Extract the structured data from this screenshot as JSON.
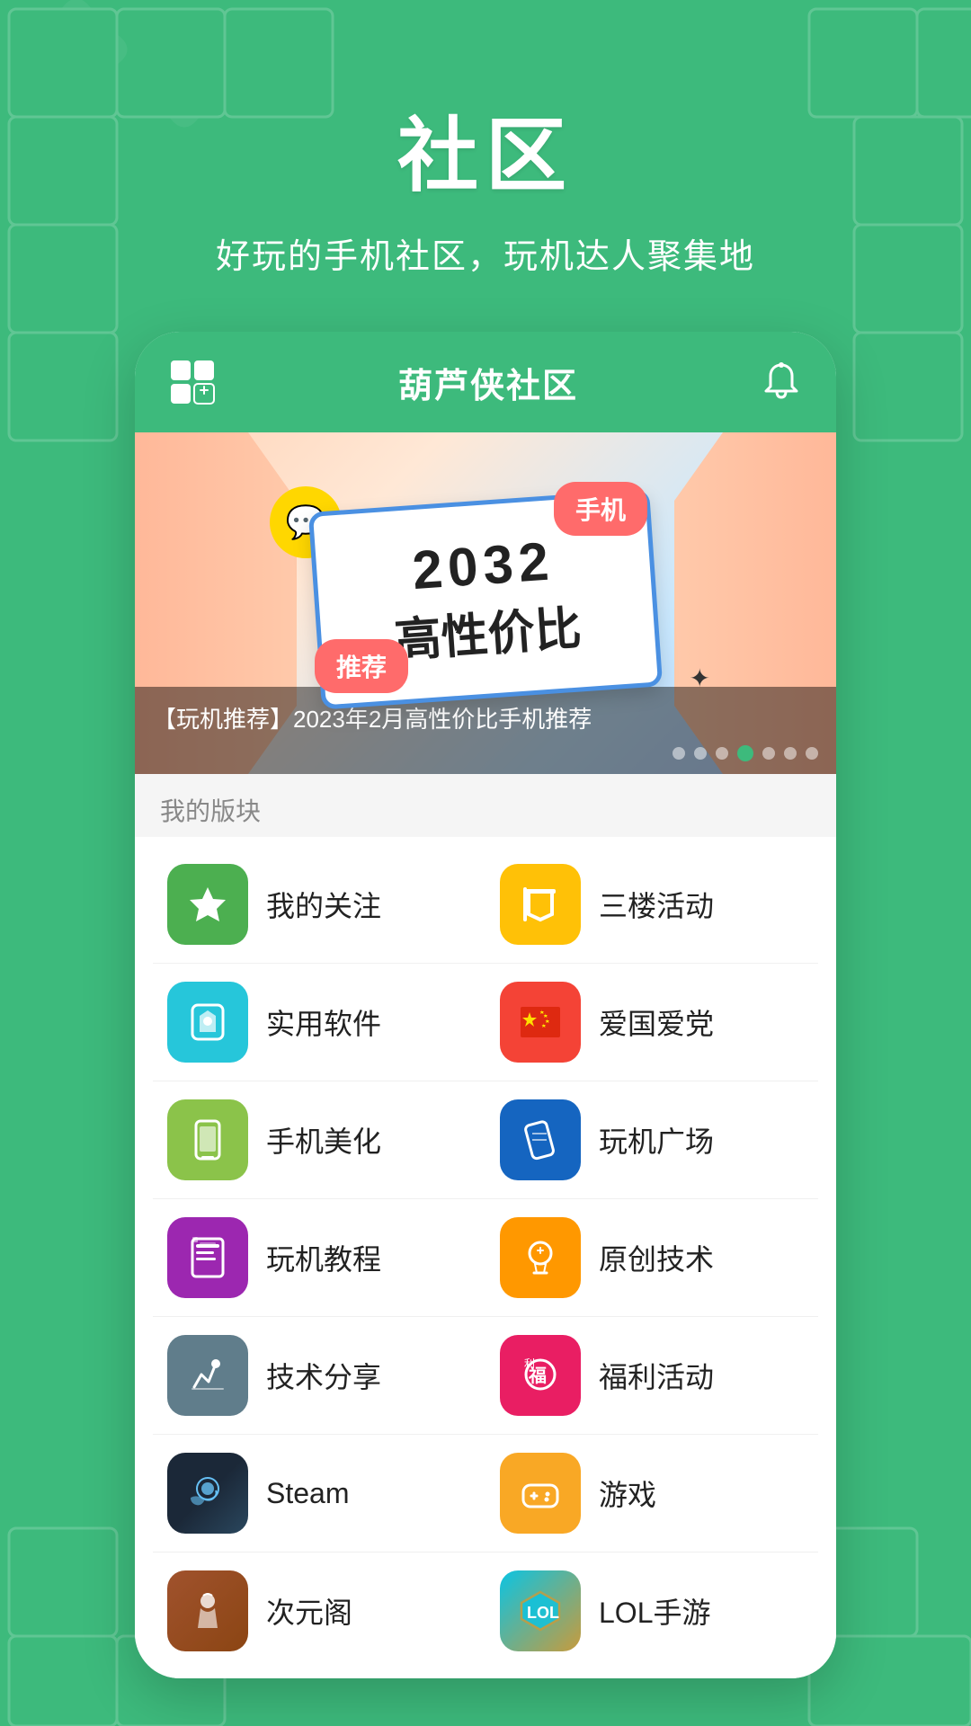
{
  "page": {
    "title": "社区",
    "subtitle": "好玩的手机社区，玩机达人聚集地",
    "background_color": "#3dba7c"
  },
  "header": {
    "app_name": "葫芦侠社区",
    "grid_icon_label": "grid-plus-icon",
    "bell_icon_label": "bell-icon"
  },
  "banner": {
    "year": "2032",
    "main_text": "高性价比",
    "tag_tuijian": "推荐",
    "tag_phone": "手机",
    "caption": "【玩机推荐】2023年2月高性价比手机推荐",
    "dots_count": 7,
    "active_dot": 3
  },
  "section": {
    "label": "我的版块"
  },
  "items": [
    {
      "row": 0,
      "left": {
        "label": "我的关注",
        "icon": "star",
        "color": "green"
      },
      "right": {
        "label": "三楼活动",
        "icon": "flag",
        "color": "yellow"
      }
    },
    {
      "row": 1,
      "left": {
        "label": "实用软件",
        "icon": "box",
        "color": "teal"
      },
      "right": {
        "label": "爱国爱党",
        "icon": "flag-cn",
        "color": "red"
      }
    },
    {
      "row": 2,
      "left": {
        "label": "手机美化",
        "icon": "book",
        "color": "lightgreen"
      },
      "right": {
        "label": "玩机广场",
        "icon": "mobile",
        "color": "blue"
      }
    },
    {
      "row": 3,
      "left": {
        "label": "玩机教程",
        "icon": "bookmark",
        "color": "purple"
      },
      "right": {
        "label": "原创技术",
        "icon": "bulb",
        "color": "orange"
      }
    },
    {
      "row": 4,
      "left": {
        "label": "技术分享",
        "icon": "wrench",
        "color": "gray"
      },
      "right": {
        "label": "福利活动",
        "icon": "gift",
        "color": "pink"
      }
    },
    {
      "row": 5,
      "left": {
        "label": "Steam",
        "icon": "steam",
        "color": "dark"
      },
      "right": {
        "label": "游戏",
        "icon": "gamepad",
        "color": "gold"
      }
    },
    {
      "row": 6,
      "left": {
        "label": "次元阁",
        "icon": "anime",
        "color": "anime"
      },
      "right": {
        "label": "LOL手游",
        "icon": "lol",
        "color": "lol"
      }
    }
  ]
}
